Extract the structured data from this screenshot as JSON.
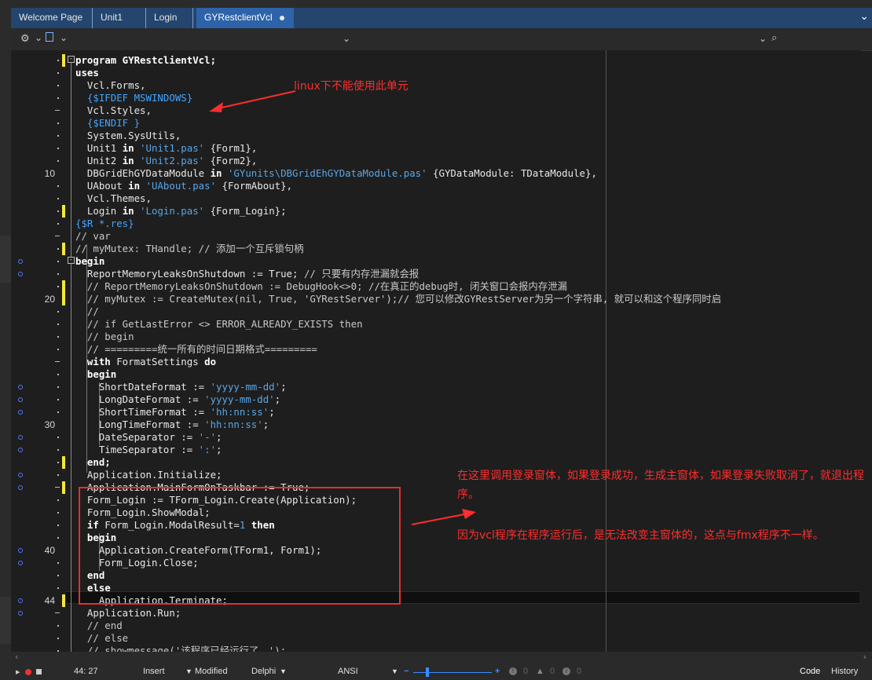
{
  "tabs": [
    {
      "label": "Welcome Page"
    },
    {
      "label": "Unit1"
    },
    {
      "label": "Login"
    },
    {
      "label": "GYRestclientVcl"
    }
  ],
  "gutter_numbers": {
    "l10": "10",
    "l20": "20",
    "l30": "30",
    "l40": "40",
    "l44": "44"
  },
  "code": {
    "l1": "program GYRestclientVcl;",
    "l2": "uses",
    "l3": "  Vcl.Forms,",
    "l4": "  {$IFDEF MSWINDOWS}",
    "l5": "  Vcl.Styles,",
    "l6": "  {$ENDIF }",
    "l7": "  System.SysUtils,",
    "l8a": "  Unit1 ",
    "l8b": "in",
    "l8c": " 'Unit1.pas'",
    "l8d": " {Form1},",
    "l9a": "  Unit2 ",
    "l9b": "in",
    "l9c": " 'Unit2.pas'",
    "l9d": " {Form2},",
    "l10a": "  DBGridEhGYDataModule ",
    "l10b": "in",
    "l10c": " 'GYunits\\DBGridEhGYDataModule.pas'",
    "l10d": " {GYDataModule: TDataModule},",
    "l11a": "  UAbout ",
    "l11b": "in",
    "l11c": " 'UAbout.pas'",
    "l11d": " {FormAbout},",
    "l12": "  Vcl.Themes,",
    "l13a": "  Login ",
    "l13b": "in",
    "l13c": " 'Login.pas'",
    "l13d": " {Form_Login};",
    "l14": "{$R *.res}",
    "l15": "// var",
    "l16": "// myMutex: THandle; // 添加一个互斥锁句柄",
    "l17": "begin",
    "l18a": "  ReportMemoryLeaksOnShutdown := True; ",
    "l18b": "// 只要有内存泄漏就会报",
    "l19": "  // ReportMemoryLeaksOnShutdown := DebugHook<>0; //在真正的debug时, 闭关窗口会报内存泄漏",
    "l20": "  // myMutex := CreateMutex(nil, True, 'GYRestServer');// 您可以修改GYRestServer为另一个字符串, 就可以和这个程序同时启",
    "l21": "  //",
    "l22": "  // if GetLastError <> ERROR_ALREADY_EXISTS then",
    "l23": "  // begin",
    "l24": "  // =========统一所有的时间日期格式=========",
    "l25a": "  with",
    "l25b": " FormatSettings ",
    "l25c": "do",
    "l26": "  begin",
    "l27a": "    ShortDateFormat := ",
    "l27b": "'yyyy-mm-dd'",
    "l27c": ";",
    "l28a": "    LongDateFormat := ",
    "l28b": "'yyyy-mm-dd'",
    "l28c": ";",
    "l29a": "    ShortTimeFormat := ",
    "l29b": "'hh:nn:ss'",
    "l29c": ";",
    "l30a": "    LongTimeFormat := ",
    "l30b": "'hh:nn:ss'",
    "l30c": ";",
    "l31a": "    DateSeparator := ",
    "l31b": "'-'",
    "l31c": ";",
    "l32a": "    TimeSeparator := ",
    "l32b": "':'",
    "l32c": ";",
    "l33": "  end;",
    "l34": "  Application.Initialize;",
    "l35": "  Application.MainFormOnTaskbar := True;",
    "l36": "  Form_Login := TForm_Login.Create(Application);",
    "l37": "  Form_Login.ShowModal;",
    "l38a": "  if",
    "l38b": " Form_Login.ModalResult=",
    "l38c": "1",
    "l38d": " then",
    "l39": "  begin",
    "l40": "    Application.CreateForm(TForm1, Form1);",
    "l41": "    Form_Login.Close;",
    "l42": "  end",
    "l43": "  else",
    "l44": "    Application.Terminate;",
    "l45": "  Application.Run;",
    "l46": "  // end",
    "l47": "  // else",
    "l48": "  // showmessage('该程序已经运行了。');"
  },
  "annotations": {
    "a1": "linux下不能使用此单元",
    "a2": "在这里调用登录窗体，如果登录成功，生成主窗体，如果登录失败取消了，就退出程序。",
    "a3": "因为vcl程序在程序运行后，是无法改变主窗体的，这点与fmx程序不一样。"
  },
  "status": {
    "position": "44: 27",
    "insert": "Insert",
    "modified": "Modified",
    "language": "Delphi",
    "encoding": "ANSI",
    "err_count": "0",
    "warn_count": "0",
    "hint_count": "0",
    "code_tab": "Code",
    "history_tab": "History"
  },
  "colors": {
    "accent": "#2d63a8",
    "tabbar": "#23456e",
    "annotation": "#ff2d2d",
    "modified_marker": "#f5e63a",
    "breakpoint": "#4e79ff"
  }
}
